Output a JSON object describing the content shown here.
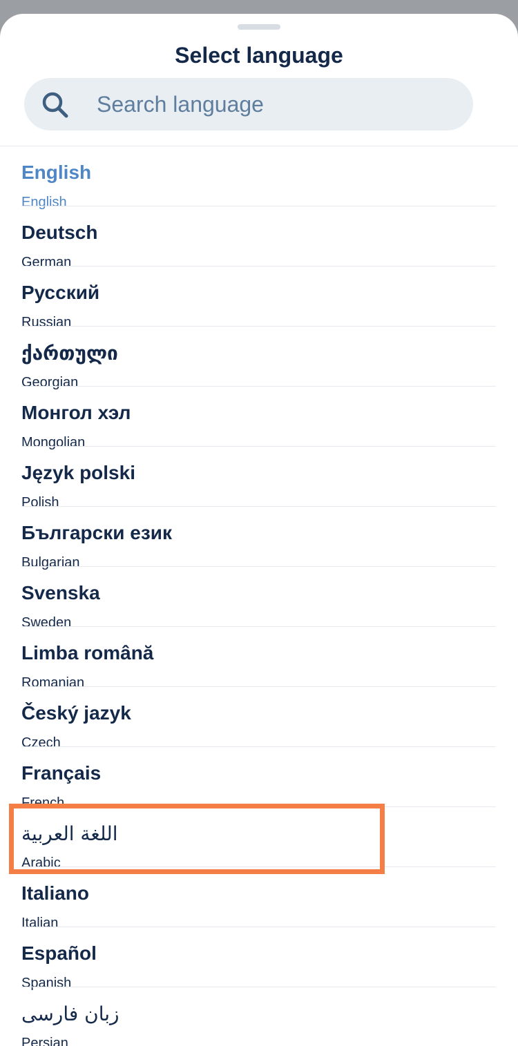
{
  "sheet": {
    "title": "Select language"
  },
  "search": {
    "placeholder": "Search language",
    "value": "",
    "icon": "search-icon"
  },
  "colors": {
    "title": "#14294a",
    "selected": "#4f86c6",
    "highlight": "#f47e45",
    "search_bg": "#e9eef3"
  },
  "languages": [
    {
      "native": "English",
      "english": "English",
      "selected": true
    },
    {
      "native": "Deutsch",
      "english": "German"
    },
    {
      "native": "Русский",
      "english": "Russian"
    },
    {
      "native": "ქართული",
      "english": "Georgian"
    },
    {
      "native": "Монгол хэл",
      "english": "Mongolian"
    },
    {
      "native": "Język polski",
      "english": "Polish"
    },
    {
      "native": "Български език",
      "english": "Bulgarian"
    },
    {
      "native": "Svenska",
      "english": "Sweden"
    },
    {
      "native": "Limba română",
      "english": "Romanian"
    },
    {
      "native": "Český jazyk",
      "english": "Czech"
    },
    {
      "native": "Français",
      "english": "French"
    },
    {
      "native": "اللغة العربية",
      "english": "Arabic"
    },
    {
      "native": "Italiano",
      "english": "Italian"
    },
    {
      "native": "Español",
      "english": "Spanish"
    },
    {
      "native": "زبان فارسی",
      "english": "Persian"
    }
  ]
}
